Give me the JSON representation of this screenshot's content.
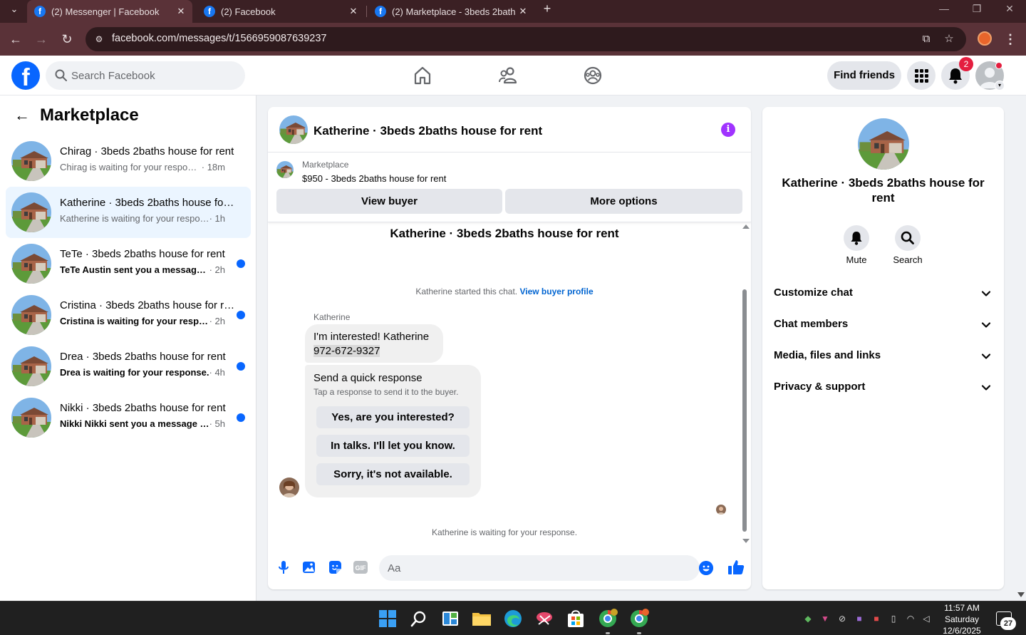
{
  "browser": {
    "tabs": [
      {
        "title": "(2) Messenger | Facebook",
        "active": true
      },
      {
        "title": "(2) Facebook",
        "active": false
      },
      {
        "title": "(2) Marketplace - 3beds 2baths house for rent",
        "active": false
      }
    ],
    "url": "facebook.com/messages/t/1566959087639237",
    "colors": {
      "tabbar": "#3b2024",
      "toolbar": "#5a3238",
      "omnibox": "#2e1a1d"
    }
  },
  "fb_header": {
    "search_placeholder": "Search Facebook",
    "find_friends_label": "Find friends",
    "notification_count": "2",
    "brand_color": "#0866ff"
  },
  "sidebar": {
    "title": "Marketplace",
    "conversations": [
      {
        "name": "Chirag · 3beds 2baths house for rent",
        "preview": "Chirag is waiting for your response. ",
        "time": "· 18m",
        "unread": false,
        "selected": false
      },
      {
        "name": "Katherine · 3beds 2baths house for rent",
        "preview": "Katherine is waiting for your response. ",
        "time": "· 1h",
        "unread": false,
        "selected": true
      },
      {
        "name": "TeTe · 3beds 2baths house for rent",
        "preview": "TeTe Austin sent you a message about your listing",
        "time": " · 2h",
        "unread": true,
        "selected": false
      },
      {
        "name": "Cristina · 3beds 2baths house for rent",
        "preview": "Cristina is waiting for your response.",
        "time": " · 2h",
        "unread": true,
        "selected": false
      },
      {
        "name": "Drea · 3beds 2baths house for rent",
        "preview": "Drea is waiting for your response. ",
        "time": "· 4h",
        "unread": true,
        "selected": false
      },
      {
        "name": "Nikki · 3beds 2baths house for rent",
        "preview": "Nikki Nikki sent you a message about your listing",
        "time": " · 5h",
        "unread": true,
        "selected": false
      }
    ]
  },
  "chat": {
    "title": "Katherine · 3beds 2baths house for rent",
    "listing": {
      "source": "Marketplace",
      "price_title": "$950 - 3beds 2baths house for rent",
      "view_buyer_label": "View buyer",
      "more_options_label": "More options"
    },
    "top_name": "Katherine · 3beds 2baths house for rent",
    "started_text": "Katherine started this chat. ",
    "view_buyer_profile": "View buyer profile",
    "sender_name": "Katherine",
    "message_line1": "I'm interested!  Katherine",
    "message_phone": "972-672-9327",
    "quick_response": {
      "title": "Send a quick response",
      "subtitle": "Tap a response to send it to the buyer.",
      "options": [
        "Yes, are you interested?",
        "In talks. I'll let you know.",
        "Sorry, it's not available."
      ]
    },
    "waiting_text": "Katherine is waiting for your response.",
    "composer_placeholder": "Aa",
    "icons": [
      "microphone-icon",
      "photo-icon",
      "sticker-icon",
      "gif-icon",
      "emoji-icon",
      "thumbs-up-icon"
    ],
    "gif_label": "GIF"
  },
  "details": {
    "name": "Katherine · 3beds 2baths house for rent",
    "actions": [
      {
        "label": "Mute"
      },
      {
        "label": "Search"
      }
    ],
    "sections": [
      "Customize chat",
      "Chat members",
      "Media, files and links",
      "Privacy & support"
    ]
  },
  "taskbar": {
    "time": "11:57 AM",
    "day": "Saturday",
    "date": "12/6/2025",
    "notification_count": "27"
  }
}
